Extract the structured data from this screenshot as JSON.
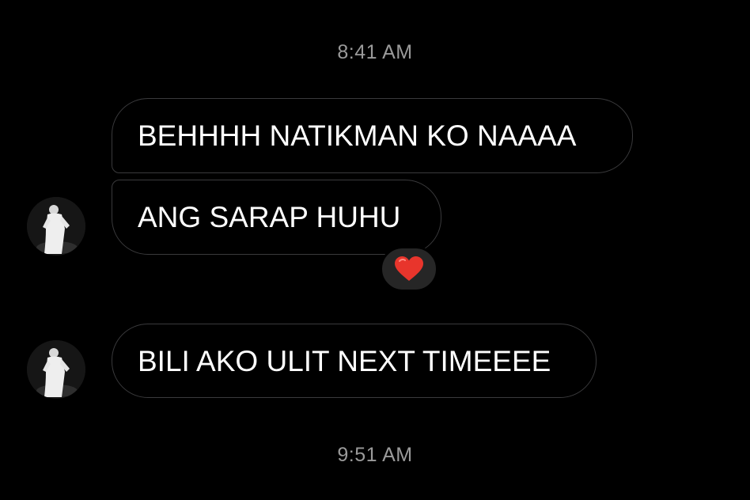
{
  "timestamps": {
    "top": "8:41 AM",
    "bottom": "9:51 AM"
  },
  "messages": [
    {
      "text": "BEHHHH NATIKMAN KO NAAAA"
    },
    {
      "text": "ANG SARAP HUHU",
      "reaction": "heart-emoji"
    },
    {
      "text": "BILI AKO ULIT NEXT TIMEEEE"
    }
  ],
  "colors": {
    "background": "#000000",
    "bubble_border": "#3a3a3c",
    "timestamp": "#9a9a9a",
    "reaction_bg": "#262626",
    "heart": "#e8352c"
  }
}
